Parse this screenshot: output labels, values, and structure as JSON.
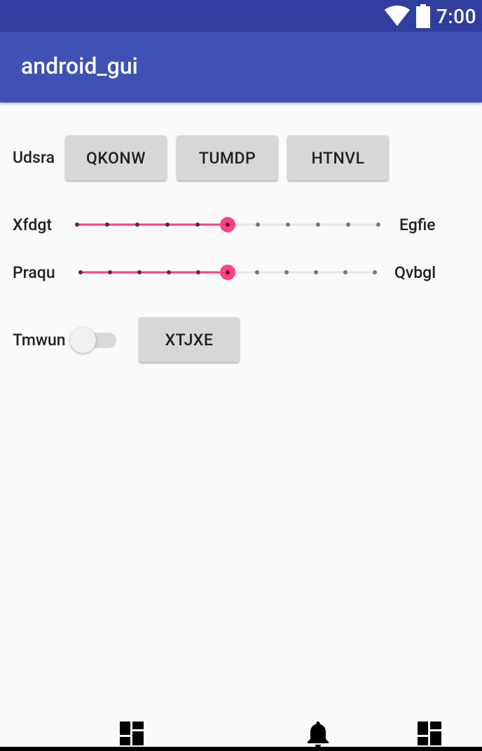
{
  "status_bar": {
    "time": "7:00",
    "icons": [
      "wifi-icon",
      "battery-icon"
    ]
  },
  "app_bar": {
    "title": "android_gui"
  },
  "row1": {
    "label": "Udsra",
    "buttons": [
      "QKONW",
      "TUMDP",
      "HTNVL"
    ]
  },
  "slider1": {
    "left_label": "Xfdgt",
    "right_label": "Egfie",
    "value": 5,
    "max": 10
  },
  "slider2": {
    "left_label": "Praqu",
    "right_label": "Qvbgl",
    "value": 5,
    "max": 10
  },
  "row4": {
    "switch_label": "Tmwun",
    "switch_on": false,
    "button": "XTJXE"
  },
  "bottom_nav": {
    "icons": [
      "dashboard-icon",
      "bell-icon",
      "dashboard-icon"
    ]
  },
  "colors": {
    "status_bar": "#303f9f",
    "app_bar": "#3f51b5",
    "accent": "#ff4081",
    "background": "#fafafa",
    "button": "#d6d7d7"
  }
}
